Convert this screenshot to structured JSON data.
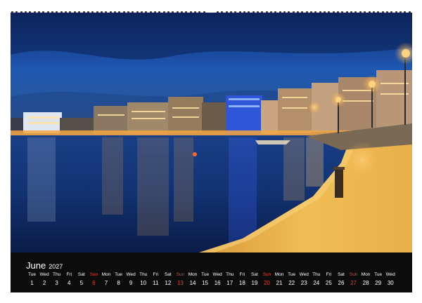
{
  "calendar": {
    "month": "June",
    "year": "2027",
    "accent_sunday_color": "#e0452f",
    "days": [
      {
        "dow": "Tue",
        "num": "1"
      },
      {
        "dow": "Wed",
        "num": "2"
      },
      {
        "dow": "Thu",
        "num": "3"
      },
      {
        "dow": "Fri",
        "num": "4"
      },
      {
        "dow": "Sat",
        "num": "5"
      },
      {
        "dow": "Sun",
        "num": "6"
      },
      {
        "dow": "Mon",
        "num": "7"
      },
      {
        "dow": "Tue",
        "num": "8"
      },
      {
        "dow": "Wed",
        "num": "9"
      },
      {
        "dow": "Thu",
        "num": "10"
      },
      {
        "dow": "Fri",
        "num": "11"
      },
      {
        "dow": "Sat",
        "num": "12"
      },
      {
        "dow": "Sun",
        "num": "13"
      },
      {
        "dow": "Mon",
        "num": "14"
      },
      {
        "dow": "Tue",
        "num": "15"
      },
      {
        "dow": "Wed",
        "num": "16"
      },
      {
        "dow": "Thu",
        "num": "17"
      },
      {
        "dow": "Fri",
        "num": "18"
      },
      {
        "dow": "Sat",
        "num": "19"
      },
      {
        "dow": "Sun",
        "num": "20"
      },
      {
        "dow": "Mon",
        "num": "21"
      },
      {
        "dow": "Tue",
        "num": "22"
      },
      {
        "dow": "Wed",
        "num": "23"
      },
      {
        "dow": "Thu",
        "num": "24"
      },
      {
        "dow": "Fri",
        "num": "25"
      },
      {
        "dow": "Sat",
        "num": "26"
      },
      {
        "dow": "Sun",
        "num": "27"
      },
      {
        "dow": "Mon",
        "num": "28"
      },
      {
        "dow": "Tue",
        "num": "29"
      },
      {
        "dow": "Wed",
        "num": "30"
      }
    ]
  },
  "photo": {
    "subject": "night-harbor-promenade-photo"
  }
}
